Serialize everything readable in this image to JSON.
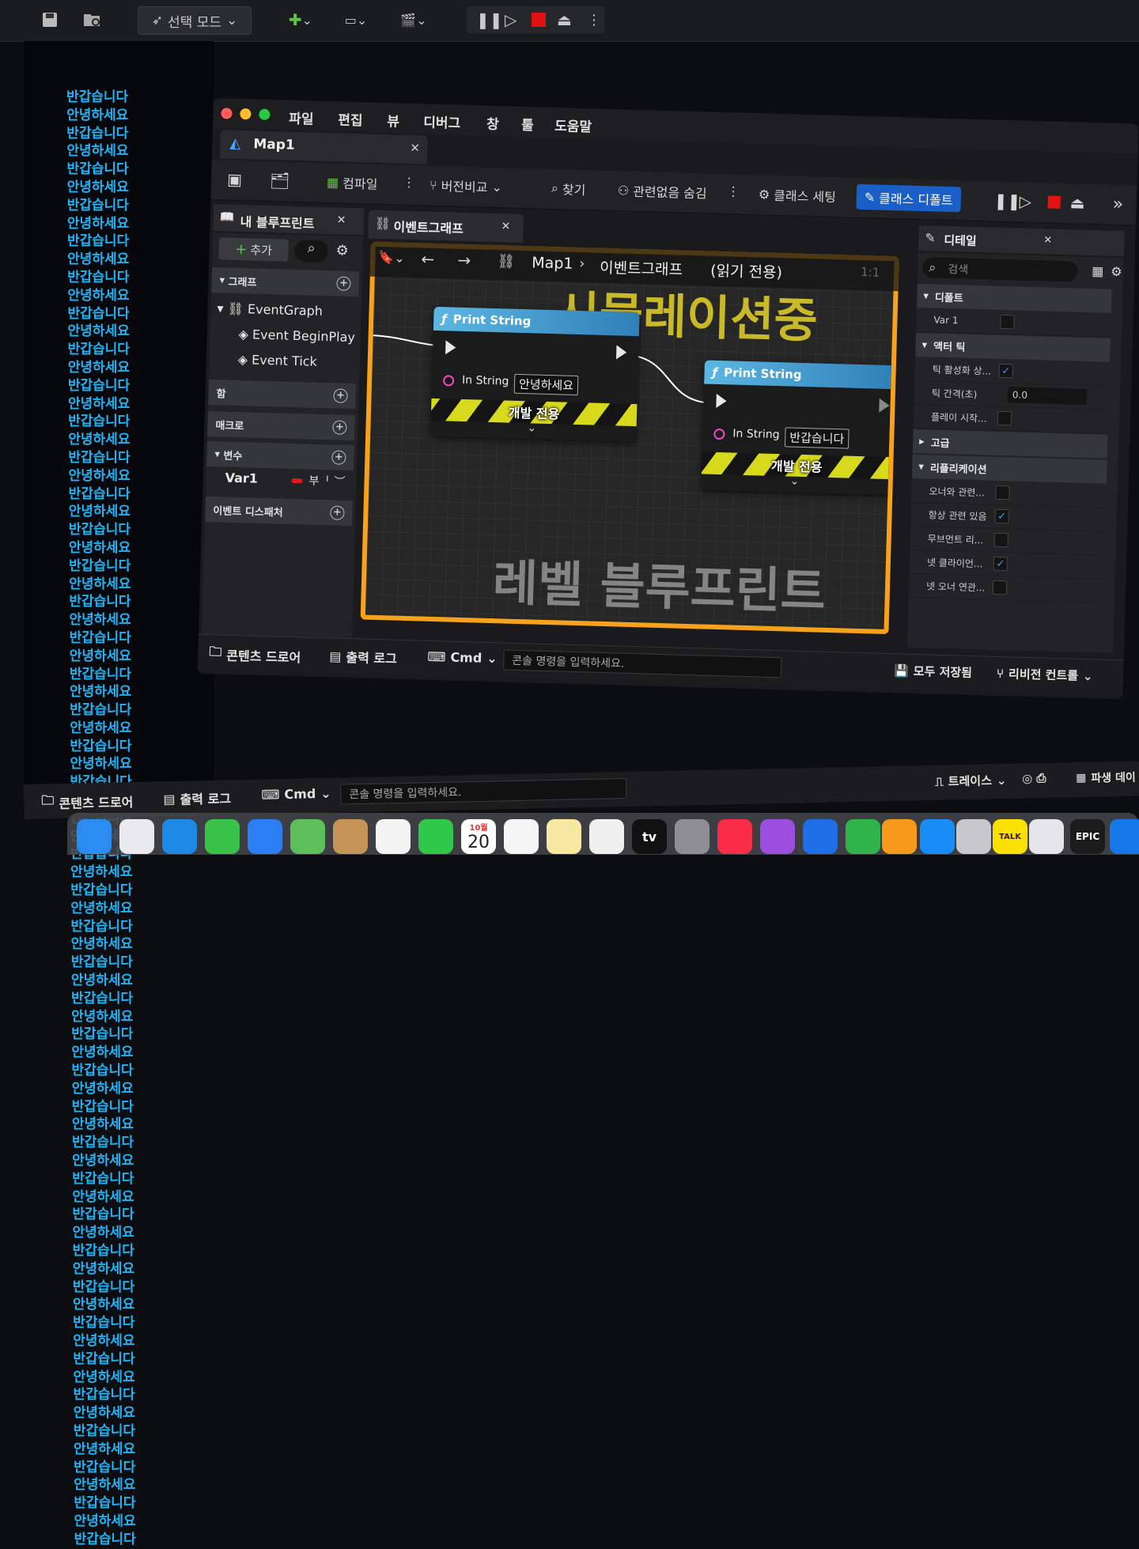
{
  "outer_toolbar": {
    "mode_label": "선택 모드",
    "save_icon": "save-icon",
    "browse_icon": "folder-search-icon"
  },
  "log_lines": [
    "반갑습니다",
    "안녕하세요",
    "반갑습니다",
    "안녕하세요",
    "반갑습니다",
    "안녕하세요",
    "반갑습니다",
    "안녕하세요",
    "반갑습니다",
    "안녕하세요",
    "반갑습니다",
    "안녕하세요",
    "반갑습니다",
    "안녕하세요",
    "반갑습니다",
    "안녕하세요",
    "반갑습니다",
    "안녕하세요",
    "반갑습니다",
    "안녕하세요",
    "반갑습니다",
    "안녕하세요",
    "반갑습니다",
    "안녕하세요",
    "반갑습니다",
    "안녕하세요",
    "반갑습니다",
    "안녕하세요",
    "반갑습니다",
    "안녕하세요",
    "반갑습니다",
    "안녕하세요",
    "반갑습니다",
    "안녕하세요",
    "반갑습니다",
    "안녕하세요",
    "반갑습니다",
    "안녕하세요",
    "반갑습니다",
    "안녕하세요",
    "반갑습니다",
    "안녕하세요",
    "반갑습니다",
    "안녕하세요",
    "반갑습니다",
    "안녕하세요",
    "반갑습니다",
    "안녕하세요",
    "반갑습니다",
    "안녕하세요",
    "반갑습니다",
    "안녕하세요",
    "반갑습니다",
    "안녕하세요",
    "반갑습니다",
    "안녕하세요",
    "반갑습니다",
    "안녕하세요",
    "반갑습니다",
    "안녕하세요",
    "반갑습니다",
    "안녕하세요",
    "반갑습니다",
    "안녕하세요",
    "반갑습니다",
    "안녕하세요",
    "반갑습니다",
    "안녕하세요",
    "반갑습니다",
    "안녕하세요",
    "반갑습니다",
    "안녕하세요",
    "반갑습니다",
    "안녕하세요",
    "반갑습니다",
    "안녕하세요",
    "반갑습니다",
    "안녕하세요",
    "반갑습니다",
    "안녕하세요",
    "반갑습니다"
  ],
  "menu": [
    "파일",
    "편집",
    "뷰",
    "디버그",
    "창",
    "툴",
    "도움말"
  ],
  "doc_tab": {
    "title": "Map1"
  },
  "bp_toolbar": {
    "compile": "컴파일",
    "diff": "버전비교",
    "find": "찾기",
    "hide_unrelated": "관련없음 숨김",
    "class_settings": "클래스 세팅",
    "class_defaults": "클래스 디폴트"
  },
  "my_blueprint": {
    "tab": "내 블루프린트",
    "add": "추가",
    "sections": {
      "graphs": "그래프",
      "functions": "함",
      "macros": "매크로",
      "variables": "변수",
      "dispatchers": "이벤트 디스패처"
    },
    "graph_items": [
      "EventGraph",
      "Event BeginPlay",
      "Event Tick"
    ],
    "var_name": "Var1",
    "var_type": "부ᅵ"
  },
  "graph": {
    "tab": "이벤트그래프",
    "crumb_root": "Map1",
    "crumb_leaf": "이벤트그래프",
    "readonly": "(읽기 전용)",
    "zoom": "1:1",
    "sim_watermark": "시뮬레이션중",
    "level_watermark": "레벨 블루프린트",
    "nodes": [
      {
        "title": "Print String",
        "pin_label": "In String",
        "value": "안녕하세요",
        "dev": "개발 전용"
      },
      {
        "title": "Print String",
        "pin_label": "In String",
        "value": "반갑습니다",
        "dev": "개발 전용"
      }
    ]
  },
  "details": {
    "tab": "디테일",
    "search_placeholder": "검색",
    "sec_default": "디폴트",
    "var1_label": "Var 1",
    "sec_actor_tick": "액터 틱",
    "tick_enabled": "틱 활성화 상...",
    "tick_interval": "틱 간격(초)",
    "tick_interval_value": "0.0",
    "play_start": "플레이 시작...",
    "sec_advanced": "고급",
    "sec_replication": "리플리케이션",
    "owner_relevant": "오너와 관련...",
    "always_relevant": "항상 관련 있음",
    "movement_rep": "무브먼트 리...",
    "net_client": "넷 클라이언...",
    "net_owner": "넷 오너 연관..."
  },
  "bottom": {
    "content_drawer": "콘텐츠 드로어",
    "output_log": "출력 로그",
    "cmd": "Cmd",
    "console_placeholder": "콘솔 명령을 입력하세요.",
    "save_all": "모두 저장됨",
    "revision": "리비전 컨트롤"
  },
  "outer_bottom": {
    "content_drawer": "콘텐츠 드로어",
    "output_log": "출력 로그",
    "cmd": "Cmd",
    "console_placeholder": "콘솔 명령을 입력하세요.",
    "trace": "트레이스",
    "derived": "파생 데이"
  },
  "dock": {
    "cal_month": "10월",
    "cal_day": "20",
    "tv": "tv",
    "talk": "TALK",
    "epic": "EPIC"
  }
}
